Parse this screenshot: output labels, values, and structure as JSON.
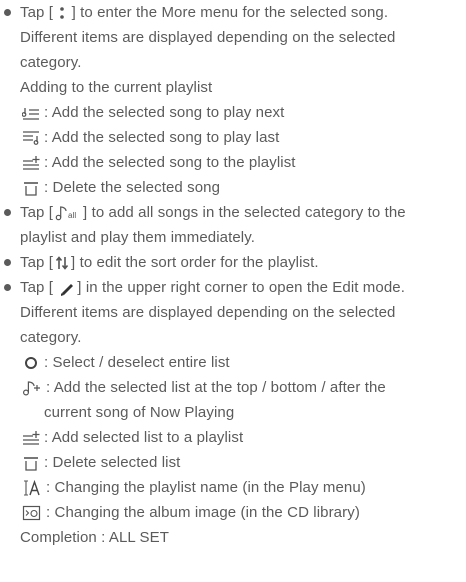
{
  "items": {
    "l1_pre": "Tap [ ",
    "l1_icon": "more-vertical-icon",
    "l1_post": " ] to enter the More menu for the selected song.",
    "l2": "Different items are displayed depending on the selected",
    "l3": "category.",
    "l4": "Adding to the current playlist",
    "l5": ": Add the selected song to play next",
    "l6": ": Add the selected song to play last",
    "l7": ": Add the selected song to the playlist",
    "l8": ": Delete the selected song",
    "l9_pre": "Tap [",
    "l9_icon": "play-all-icon",
    "l9_post": "] to add all songs in the selected category to the",
    "l10": "playlist and play them immediately.",
    "l11_pre": "Tap [",
    "l11_icon": "sort-order-icon",
    "l11_post": "] to edit the sort order for the playlist.",
    "l12_pre": "Tap [ ",
    "l12_icon": "pencil-edit-icon",
    "l12_post": "] in the upper right corner to open the Edit mode.",
    "l13": "Different items are displayed depending on the selected",
    "l14": "category.",
    "l15": ": Select / deselect entire list",
    "l16": ": Add the selected list at the top / bottom / after the",
    "l17": "current song of Now Playing",
    "l18": ": Add selected list to a playlist",
    "l19": ": Delete selected list",
    "l20": ": Changing the playlist name (in the Play menu)",
    "l21": ": Changing the album image (in the CD library)",
    "l22": "Completion : ALL SET"
  },
  "colors": {
    "text": "#5b5b5b"
  }
}
